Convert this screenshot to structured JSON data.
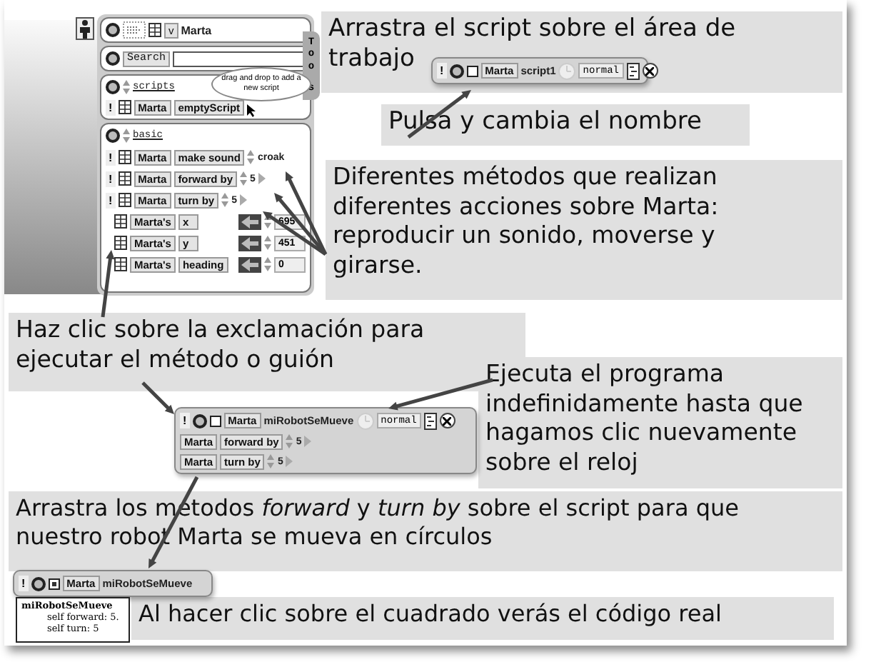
{
  "viewer": {
    "name": "Marta",
    "menu": "v",
    "search": "Search",
    "tools_tab_top": "Too",
    "tools_tab_bottom": "s",
    "scripts_category": "scripts",
    "balloon": "drag and drop to add a new script",
    "script_run": "!",
    "script_tile": [
      "Marta",
      "emptyScript"
    ],
    "basic_category": "basic",
    "rows": [
      {
        "kind": "command",
        "run": "!",
        "subject": "Marta",
        "method": "make sound",
        "value": "croak"
      },
      {
        "kind": "command",
        "run": "!",
        "subject": "Marta",
        "method": "forward by",
        "value": "5"
      },
      {
        "kind": "command",
        "run": "!",
        "subject": "Marta",
        "method": "turn by",
        "value": "5"
      },
      {
        "kind": "getter",
        "subject": "Marta's",
        "method": "x",
        "value": "695"
      },
      {
        "kind": "getter",
        "subject": "Marta's",
        "method": "y",
        "value": "451"
      },
      {
        "kind": "getter",
        "subject": "Marta's",
        "method": "heading",
        "value": "0"
      }
    ]
  },
  "notes": [
    "Arrastra el script sobre el área de trabajo",
    "Pulsa y cambia el nombre",
    "Diferentes métodos que realizan diferentes acciones sobre Marta: reproducir un sonido, moverse y girarse.",
    "Haz clic sobre la exclamación para ejecutar el método o guión",
    "Ejecuta el programa indefinidamente hasta que hagamos clic nuevamente sobre el reloj",
    "Arrastra los métodos *forward* y *turn by* sobre el script para que nuestro robot Marta se mueva en círculos",
    "Al hacer clic sobre el cuadrado verás el código real"
  ],
  "scripts": [
    {
      "run": "!",
      "subject": "Marta",
      "name": "script1",
      "mode": "normal",
      "checked": false
    },
    {
      "run": "!",
      "subject": "Marta",
      "name": "miRobotSeMueve",
      "mode": "normal",
      "checked": false,
      "lines": [
        {
          "subject": "Marta",
          "method": "forward by",
          "value": "5"
        },
        {
          "subject": "Marta",
          "method": "turn by",
          "value": "5"
        }
      ]
    }
  ],
  "code_view": {
    "run": "!",
    "subject": "Marta",
    "name": "miRobotSeMueve",
    "checked": true,
    "title": "miRobotSeMueve",
    "lines": [
      "self forward: 5.",
      "self turn: 5"
    ]
  }
}
